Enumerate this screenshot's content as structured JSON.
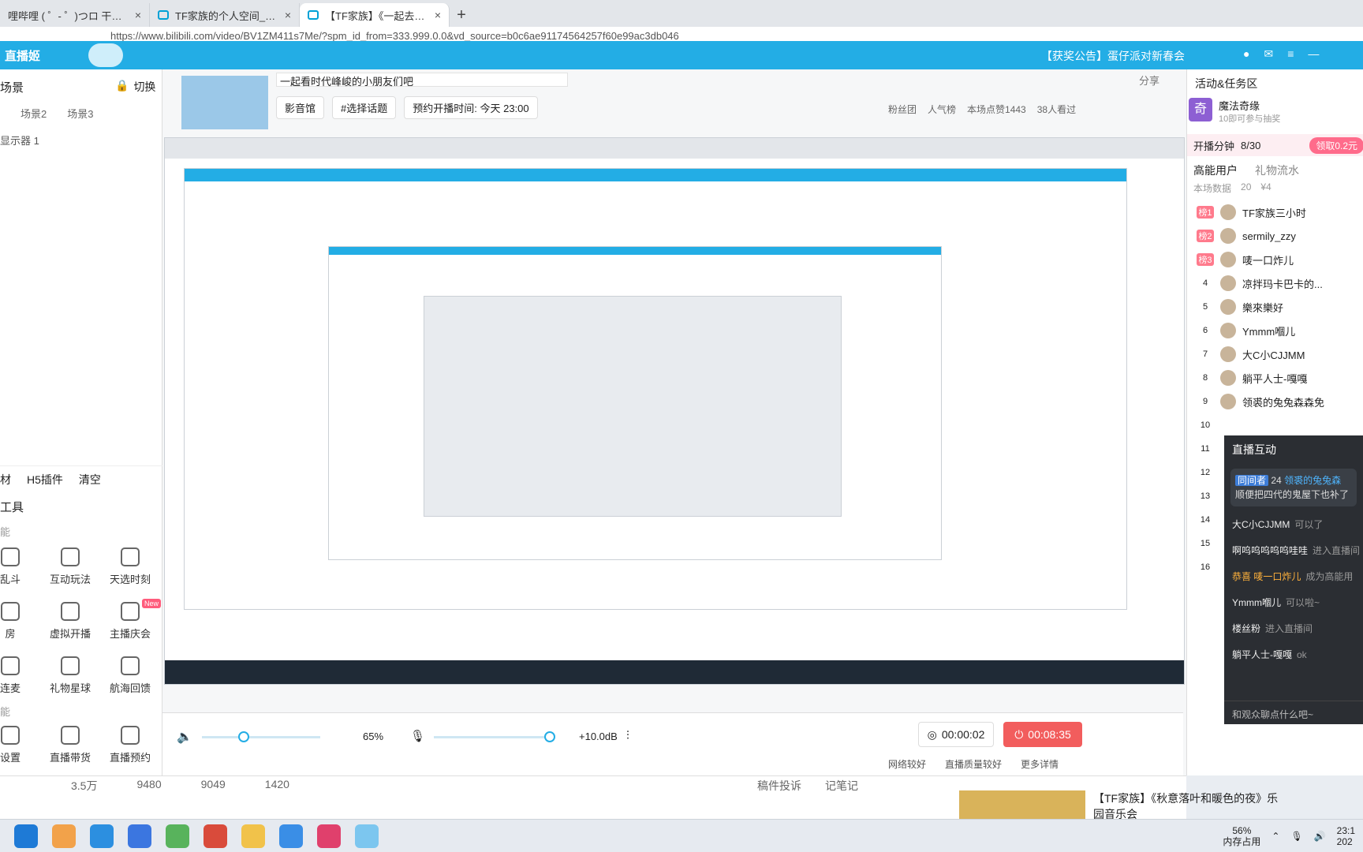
{
  "browser": {
    "tabs": [
      {
        "label": "哩哔哩 ( ゜- ゜)つロ 干杯~-bili"
      },
      {
        "label": "TF家族的个人空间_哔哩哔哩_bili"
      },
      {
        "label": "【TF家族】《一起去做的N件事》"
      }
    ],
    "url": "https://www.bilibili.com/video/BV1ZM411s7Me/?spm_id_from=333.999.0.0&vd_source=b0c6ae91174564257f60e99ac3db046"
  },
  "header": {
    "logo": "直播姬",
    "notice": "【获奖公告】蛋仔派对新春会"
  },
  "left": {
    "title": "场景",
    "switch_label": "切换",
    "scenes": [
      "场景2",
      "场景3"
    ],
    "source": "显示器 1",
    "bottom_tabs": [
      "材",
      "H5插件",
      "清空"
    ],
    "tools_title": "工具",
    "section1": "能",
    "tools": [
      {
        "label": "乱斗"
      },
      {
        "label": "互动玩法"
      },
      {
        "label": "天选时刻"
      },
      {
        "label": "房"
      },
      {
        "label": "虚拟开播"
      },
      {
        "label": "主播庆会",
        "badge": "New"
      },
      {
        "label": "连麦"
      },
      {
        "label": "礼物星球"
      },
      {
        "label": "航海回馈"
      }
    ],
    "section2": "能",
    "tools2": [
      {
        "label": "设置"
      },
      {
        "label": "直播带货"
      },
      {
        "label": "直播预约"
      }
    ]
  },
  "stream": {
    "title": "一起看时代峰峻的小朋友们吧",
    "share": "分享",
    "chips": [
      "影音馆",
      "#选择话题",
      "预约开播时间: 今天 23:00"
    ],
    "fans": "粉丝团",
    "popular": "人气榜",
    "likes": "本场点赞1443",
    "viewers": "38人看过"
  },
  "controls": {
    "volume": "65%",
    "mic": "+10.0dB",
    "timer": "00:00:02",
    "stop_time": "00:08:35"
  },
  "status": {
    "network": "网络较好",
    "quality": "直播质量较好",
    "more": "更多详情"
  },
  "bottom": {
    "stats": [
      "3.5万",
      "9480",
      "9049",
      "1420"
    ],
    "report": "稿件投诉",
    "notes": "记笔记",
    "rec_title": "【TF家族】《秋意落叶和暖色的夜》乐园音乐会"
  },
  "right": {
    "title": "活动&任务区",
    "activity_name": "魔法奇缘",
    "activity_desc": "10即可参与抽奖",
    "minutes_label": "开播分钟",
    "minutes_value": "8/30",
    "claim": "领取0.2元",
    "tab1": "高能用户",
    "tab2": "礼物流水",
    "stat_label": "本场数据",
    "stat_people": "20",
    "stat_money": "¥4",
    "users": [
      {
        "rank": "榜1",
        "name": "TF家族三小时"
      },
      {
        "rank": "榜2",
        "name": "sermily_zzy"
      },
      {
        "rank": "榜3",
        "name": "唛一口炸儿"
      },
      {
        "rank": "4",
        "name": "凉拌玛卡巴卡的..."
      },
      {
        "rank": "5",
        "name": "樂來樂好"
      },
      {
        "rank": "6",
        "name": "Ymmm嗰儿"
      },
      {
        "rank": "7",
        "name": "大C小CJJMM"
      },
      {
        "rank": "8",
        "name": "躺平人士-嘎嘎"
      },
      {
        "rank": "9",
        "name": "领裘的兔兔森森免"
      },
      {
        "rank": "10",
        "name": ""
      },
      {
        "rank": "11",
        "name": ""
      },
      {
        "rank": "12",
        "name": ""
      },
      {
        "rank": "13",
        "name": ""
      },
      {
        "rank": "14",
        "name": ""
      },
      {
        "rank": "15",
        "name": ""
      },
      {
        "rank": "16",
        "name": ""
      }
    ]
  },
  "chat": {
    "title": "直播互动",
    "badge": "同间者",
    "level": "24",
    "first_user": "领裘的兔兔森",
    "first_msg": "顺便把四代的鬼屋下也补了",
    "lines": [
      {
        "user": "大C小CJJMM",
        "msg": "可以了"
      },
      {
        "user": "啊呜呜呜呜呜哇哇",
        "msg": "进入直播间"
      },
      {
        "user": "恭喜 唛一口炸儿",
        "msg": "成为高能用"
      },
      {
        "user": "Ymmm嗰儿",
        "msg": "可以啦~"
      },
      {
        "user": "楼丝粉",
        "msg": "进入直播间"
      },
      {
        "user": "躺平人士-嘎嘎",
        "msg": "ok"
      }
    ],
    "input": "和观众聊点什么吧~"
  },
  "taskbar": {
    "mem": "56%",
    "mem_label": "内存占用",
    "time": "23:1",
    "date": "202"
  }
}
